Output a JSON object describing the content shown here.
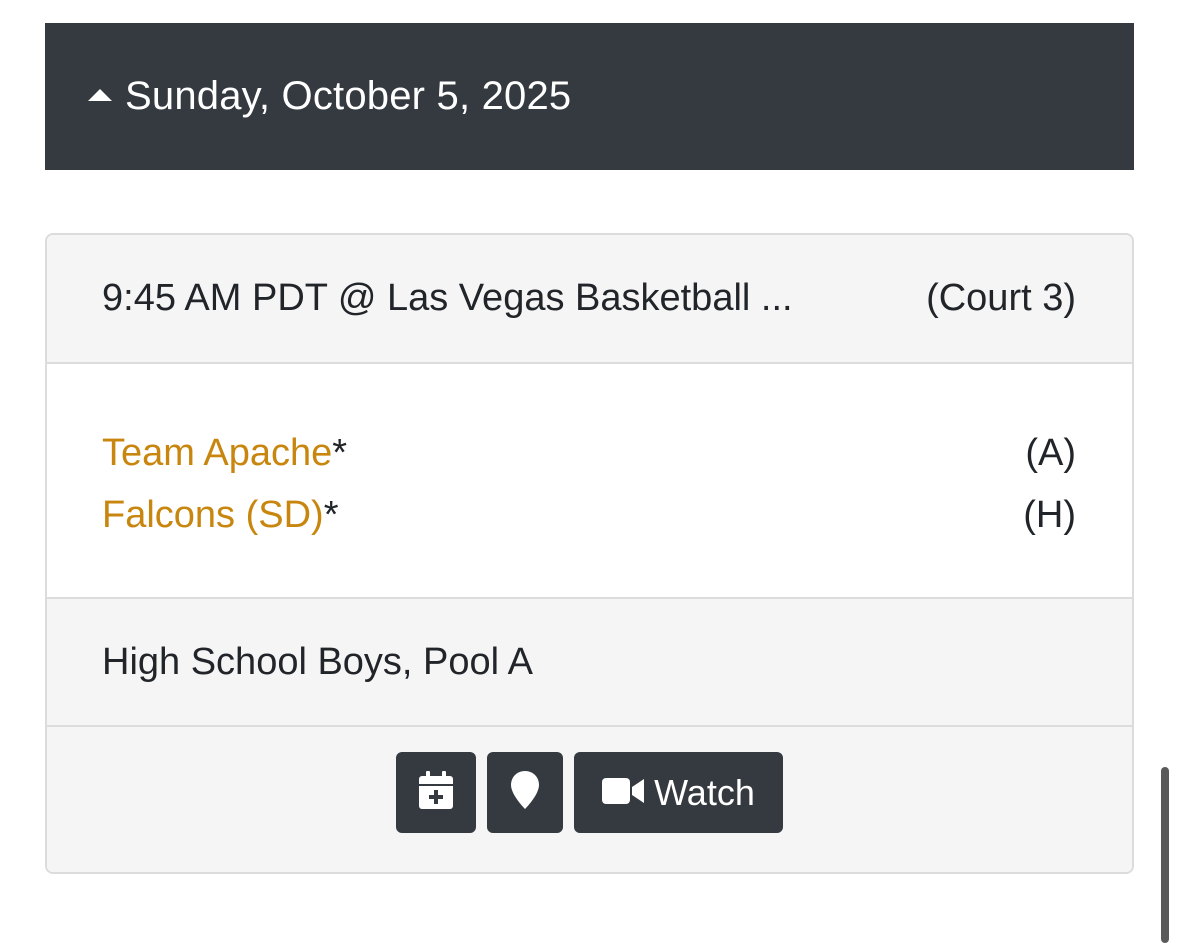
{
  "schedule": {
    "date_label": "Sunday, October 5, 2025",
    "game": {
      "time_location": "9:45 AM PDT @ Las Vegas Basketball ...",
      "court": "(Court 3)",
      "teams": [
        {
          "name": "Team Apache",
          "marker": "*",
          "side": "(A)"
        },
        {
          "name": "Falcons (SD)",
          "marker": "*",
          "side": "(H)"
        }
      ],
      "division": "High School Boys, Pool A",
      "actions": {
        "calendar_icon": "calendar-plus-icon",
        "map_icon": "map-marker-icon",
        "watch_icon": "video-camera-icon",
        "watch_label": "Watch"
      }
    }
  },
  "colors": {
    "header_bg": "#343a40",
    "team_link": "#c8860f",
    "section_bg": "#f5f5f5",
    "border": "#dcdcdc"
  }
}
